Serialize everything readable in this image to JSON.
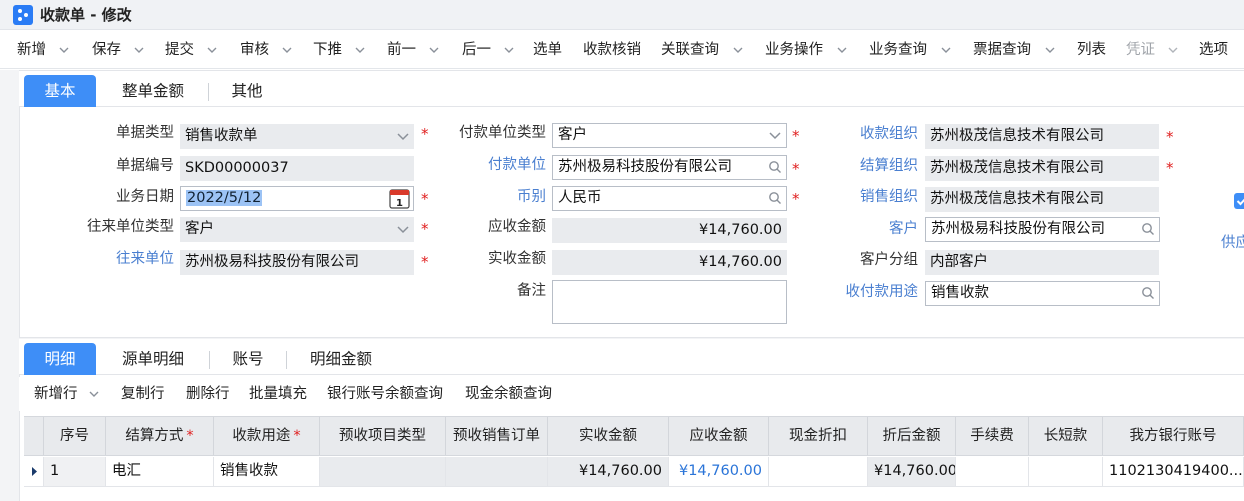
{
  "window": {
    "title": "收款单 - 修改"
  },
  "toolbar": {
    "items": [
      {
        "label": "新增",
        "dropdown": true
      },
      {
        "label": "保存",
        "dropdown": true
      },
      {
        "label": "提交",
        "dropdown": true
      },
      {
        "label": "审核",
        "dropdown": true
      },
      {
        "label": "下推",
        "dropdown": true
      },
      {
        "label": "前一",
        "dropdown": true
      },
      {
        "label": "后一",
        "dropdown": true
      },
      {
        "label": "选单",
        "dropdown": false
      },
      {
        "label": "收款核销",
        "dropdown": false
      },
      {
        "label": "关联查询",
        "dropdown": true
      },
      {
        "label": "业务操作",
        "dropdown": true
      },
      {
        "label": "业务查询",
        "dropdown": true
      },
      {
        "label": "票据查询",
        "dropdown": true
      },
      {
        "label": "列表",
        "dropdown": false
      },
      {
        "label": "凭证",
        "dropdown": true,
        "disabled": true
      },
      {
        "label": "选项",
        "dropdown": false
      }
    ]
  },
  "top_tabs": [
    {
      "label": "基本",
      "active": true
    },
    {
      "label": "整单金额",
      "active": false
    },
    {
      "label": "其他",
      "active": false
    }
  ],
  "form": {
    "bill_type_label": "单据类型",
    "bill_type_value": "销售收款单",
    "bill_no_label": "单据编号",
    "bill_no_value": "SKD00000037",
    "biz_date_label": "业务日期",
    "biz_date_value": "2022/5/12",
    "contact_type_label": "往来单位类型",
    "contact_type_value": "客户",
    "contact_unit_label": "往来单位",
    "contact_unit_value": "苏州极易科技股份有限公司",
    "payer_type_label": "付款单位类型",
    "payer_type_value": "客户",
    "payer_label": "付款单位",
    "payer_value": "苏州极易科技股份有限公司",
    "currency_label": "币别",
    "currency_value": "人民币",
    "receivable_label": "应收金额",
    "receivable_value": "¥14,760.00",
    "received_label": "实收金额",
    "received_value": "¥14,760.00",
    "remark_label": "备注",
    "remark_value": "",
    "recv_org_label": "收款组织",
    "recv_org_value": "苏州极茂信息技术有限公司",
    "settle_org_label": "结算组织",
    "settle_org_value": "苏州极茂信息技术有限公司",
    "sales_org_label": "销售组织",
    "sales_org_value": "苏州极茂信息技术有限公司",
    "customer_label": "客户",
    "customer_value": "苏州极易科技股份有限公司",
    "customer_group_label": "客户分组",
    "customer_group_value": "内部客户",
    "purpose_label": "收付款用途",
    "purpose_value": "销售收款",
    "supplier_partial_label": "供应",
    "required_mark": "*"
  },
  "detail_tabs": [
    {
      "label": "明细",
      "active": true
    },
    {
      "label": "源单明细",
      "active": false
    },
    {
      "label": "账号",
      "active": false
    },
    {
      "label": "明细金额",
      "active": false
    }
  ],
  "detail_toolbar": [
    {
      "label": "新增行",
      "dropdown": true
    },
    {
      "label": "复制行"
    },
    {
      "label": "删除行"
    },
    {
      "label": "批量填充"
    },
    {
      "label": "银行账号余额查询"
    },
    {
      "label": "现金余额查询"
    }
  ],
  "grid": {
    "columns": [
      "序号",
      "结算方式",
      "收款用途",
      "预收项目类型",
      "预收销售订单",
      "实收金额",
      "应收金额",
      "现金折扣",
      "折后金额",
      "手续费",
      "长短款",
      "我方银行账号"
    ],
    "required_columns": [
      "结算方式",
      "收款用途"
    ],
    "rows": [
      [
        "1",
        "电汇",
        "销售收款",
        "",
        "",
        "¥14,760.00",
        "¥14,760.00",
        "",
        "¥14,760.00",
        "",
        "",
        "1102130419400..."
      ]
    ]
  }
}
